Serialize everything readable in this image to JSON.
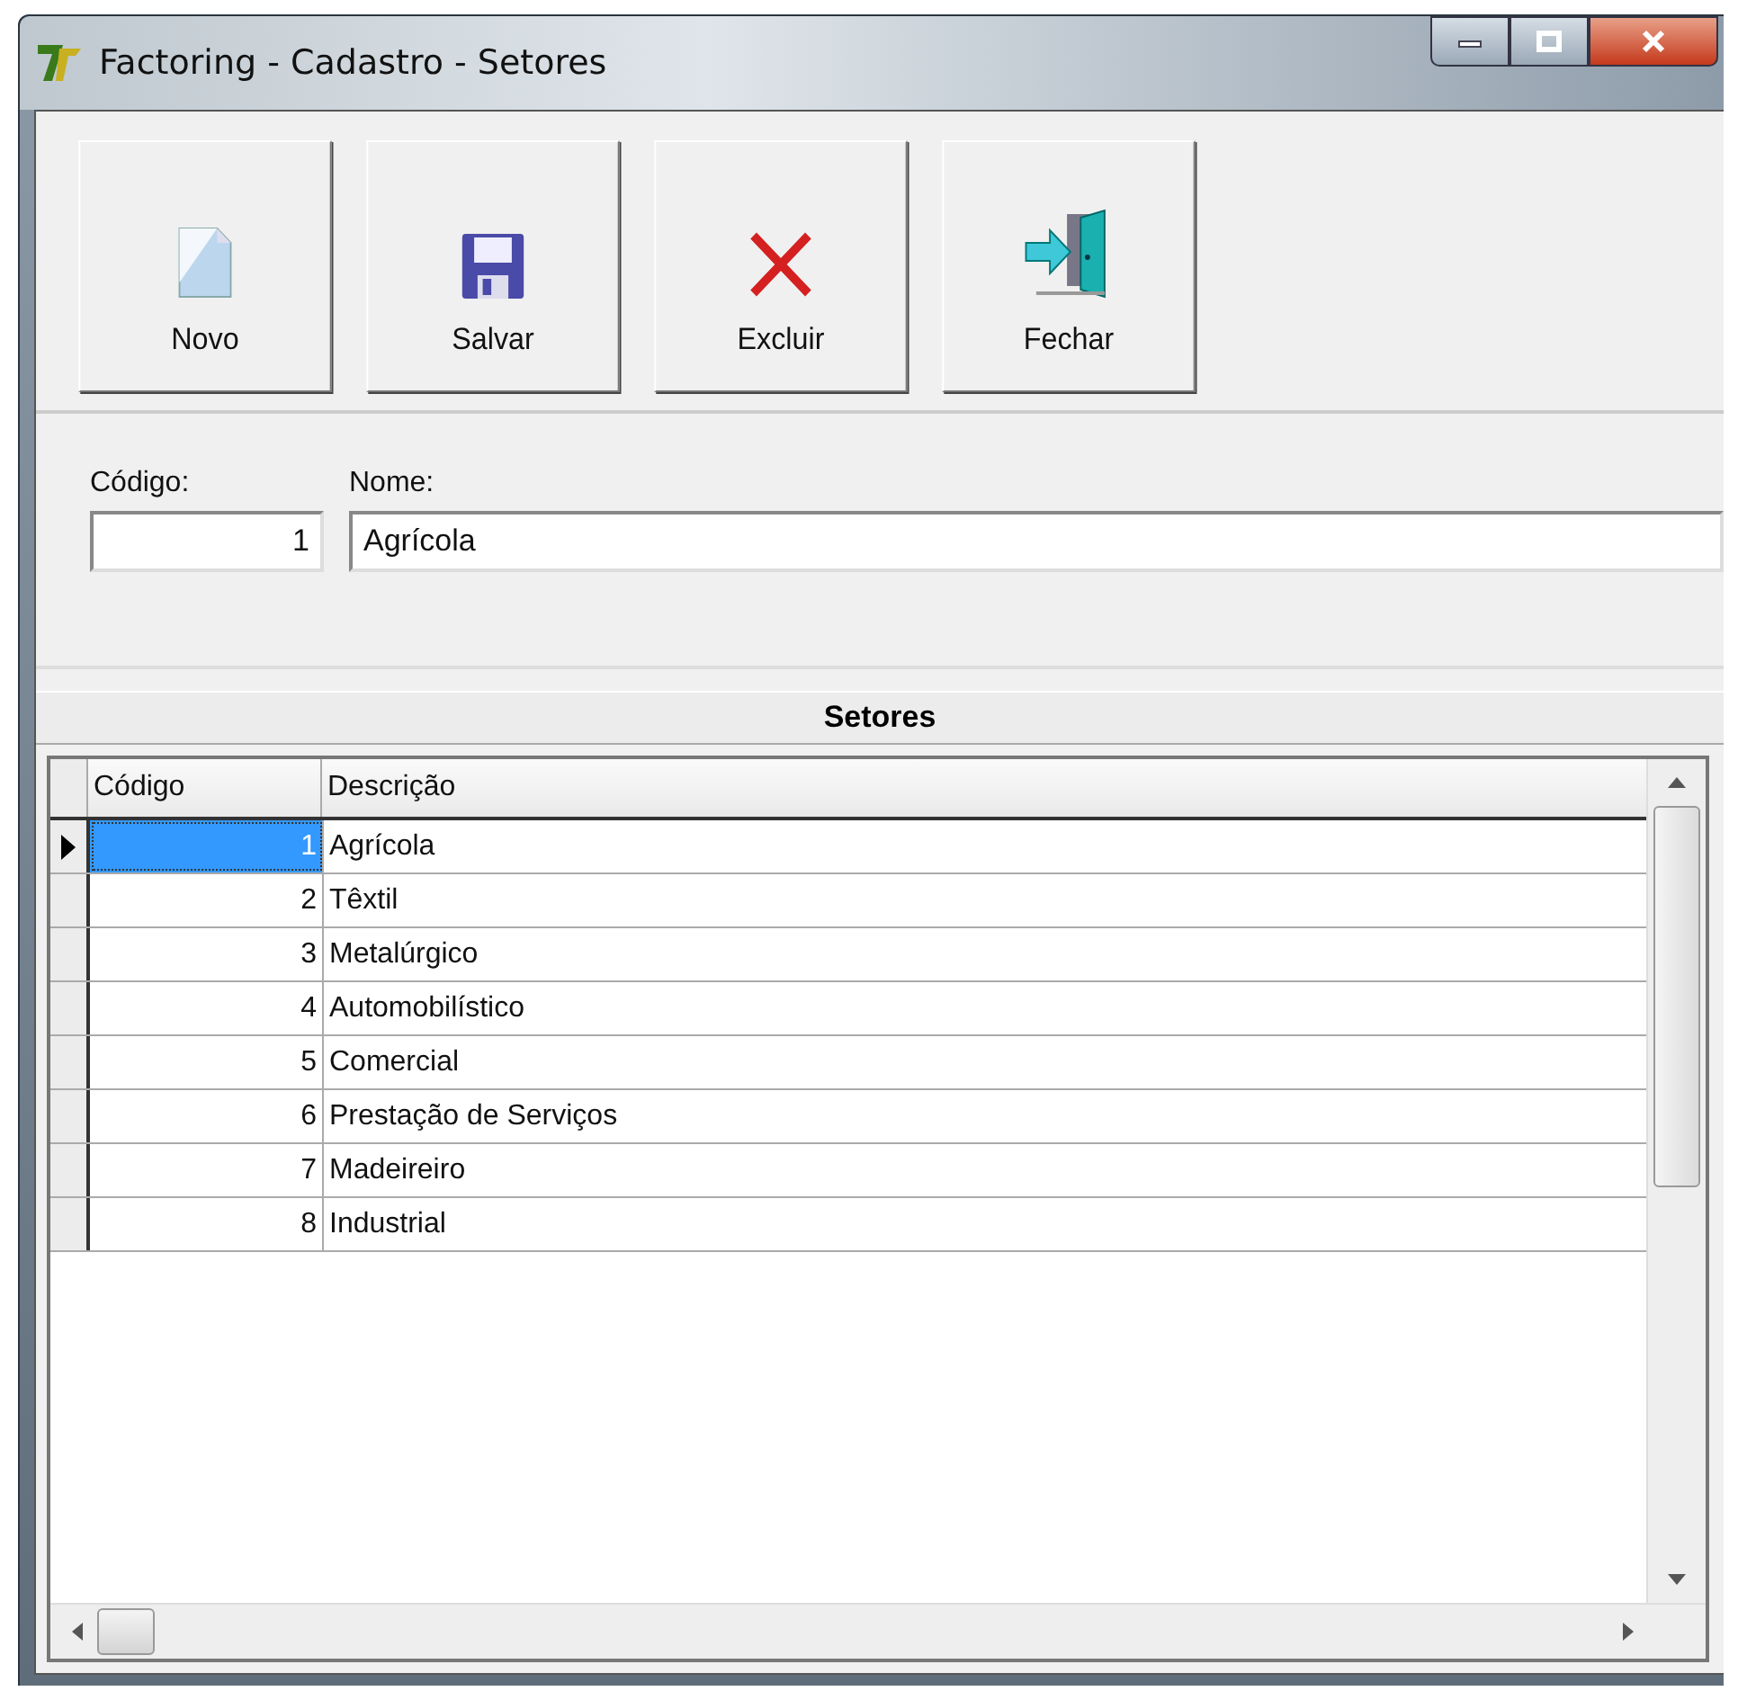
{
  "window": {
    "title": "Factoring - Cadastro - Setores"
  },
  "toolbar": [
    {
      "label": "Novo",
      "kind": "new"
    },
    {
      "label": "Salvar",
      "kind": "save"
    },
    {
      "label": "Excluir",
      "kind": "delete"
    },
    {
      "label": "Fechar",
      "kind": "exit"
    }
  ],
  "form": {
    "code": {
      "label": "Código:",
      "value": "1"
    },
    "name": {
      "label": "Nome:",
      "value": "Agrícola"
    }
  },
  "grid": {
    "title": "Setores",
    "columns": [
      "Código",
      "Descrição"
    ],
    "rows": [
      {
        "code": "1",
        "description": "Agrícola",
        "selected": true
      },
      {
        "code": "2",
        "description": "Têxtil",
        "selected": false
      },
      {
        "code": "3",
        "description": "Metalúrgico",
        "selected": false
      },
      {
        "code": "4",
        "description": "Automobilístico",
        "selected": false
      },
      {
        "code": "5",
        "description": "Comercial",
        "selected": false
      },
      {
        "code": "6",
        "description": "Prestação de Serviços",
        "selected": false
      },
      {
        "code": "7",
        "description": "Madeireiro",
        "selected": false
      },
      {
        "code": "8",
        "description": "Industrial",
        "selected": false
      }
    ]
  }
}
